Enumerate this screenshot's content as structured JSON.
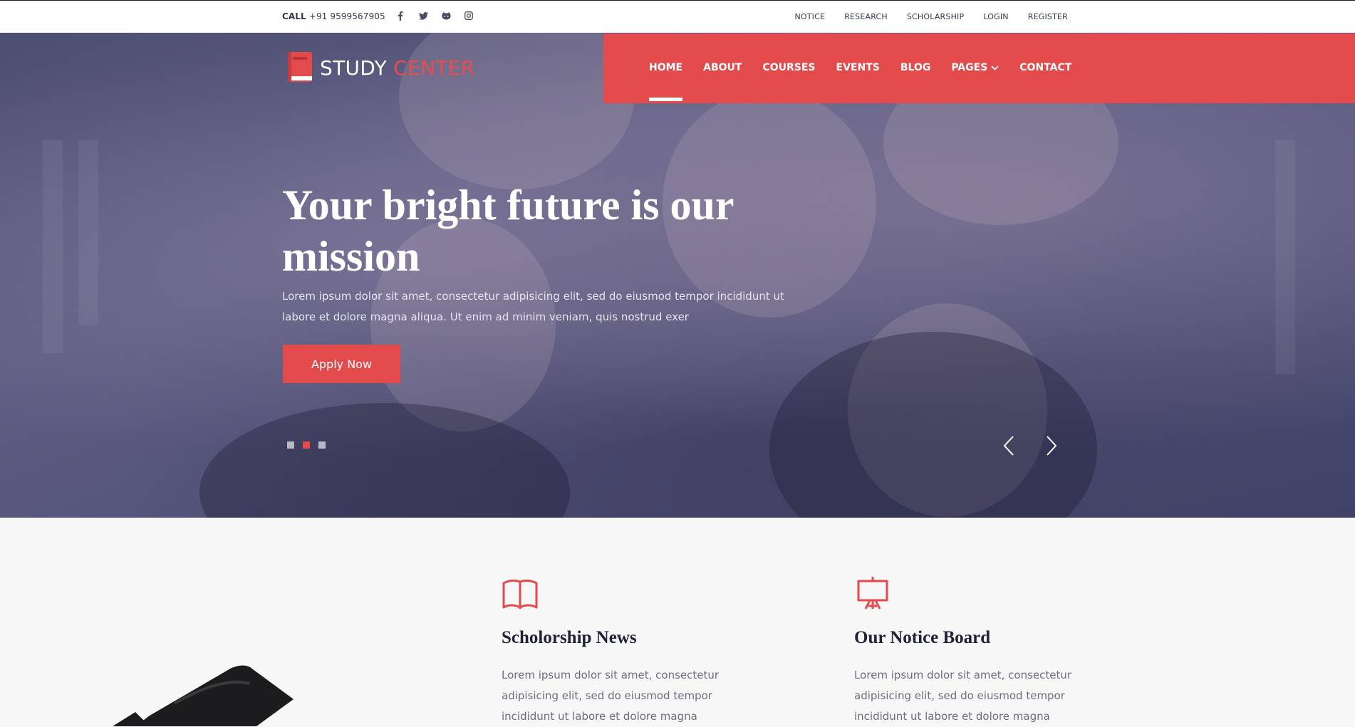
{
  "topbar": {
    "call_label": "CALL",
    "phone": "+91 9599567905",
    "social": [
      "facebook-icon",
      "twitter-icon",
      "github-icon",
      "instagram-icon"
    ],
    "links": [
      "NOTICE",
      "RESEARCH",
      "SCHOLARSHIP",
      "LOGIN",
      "REGISTER"
    ]
  },
  "logo": {
    "word1": "STUDY",
    "word2": "CENTER"
  },
  "nav": {
    "items": [
      "HOME",
      "ABOUT",
      "COURSES",
      "EVENTS",
      "BLOG",
      "PAGES",
      "CONTACT"
    ],
    "active": "HOME"
  },
  "hero": {
    "title": "Your bright future is our mission",
    "text": "Lorem ipsum dolor sit amet, consectetur adipisicing elit, sed do eiusmod tempor incididunt ut labore et dolore magna aliqua. Ut enim ad minim veniam, quis nostrud exer",
    "button": "Apply Now",
    "slides": 3,
    "active_slide": 2
  },
  "features": [
    {
      "icon": "open-book-icon",
      "title": "Scholorship News",
      "text": "Lorem ipsum dolor sit amet, consectetur adipisicing elit, sed do eiusmod tempor incididunt ut labore et dolore magna"
    },
    {
      "icon": "presentation-board-icon",
      "title": "Our Notice Board",
      "text": "Lorem ipsum dolor sit amet, consectetur adipisicing elit, sed do eiusmod tempor incididunt ut labore et dolore magna"
    }
  ],
  "colors": {
    "accent": "#e34a4c",
    "navy": "#1f2238",
    "hero_overlay": "#4d4f72"
  }
}
